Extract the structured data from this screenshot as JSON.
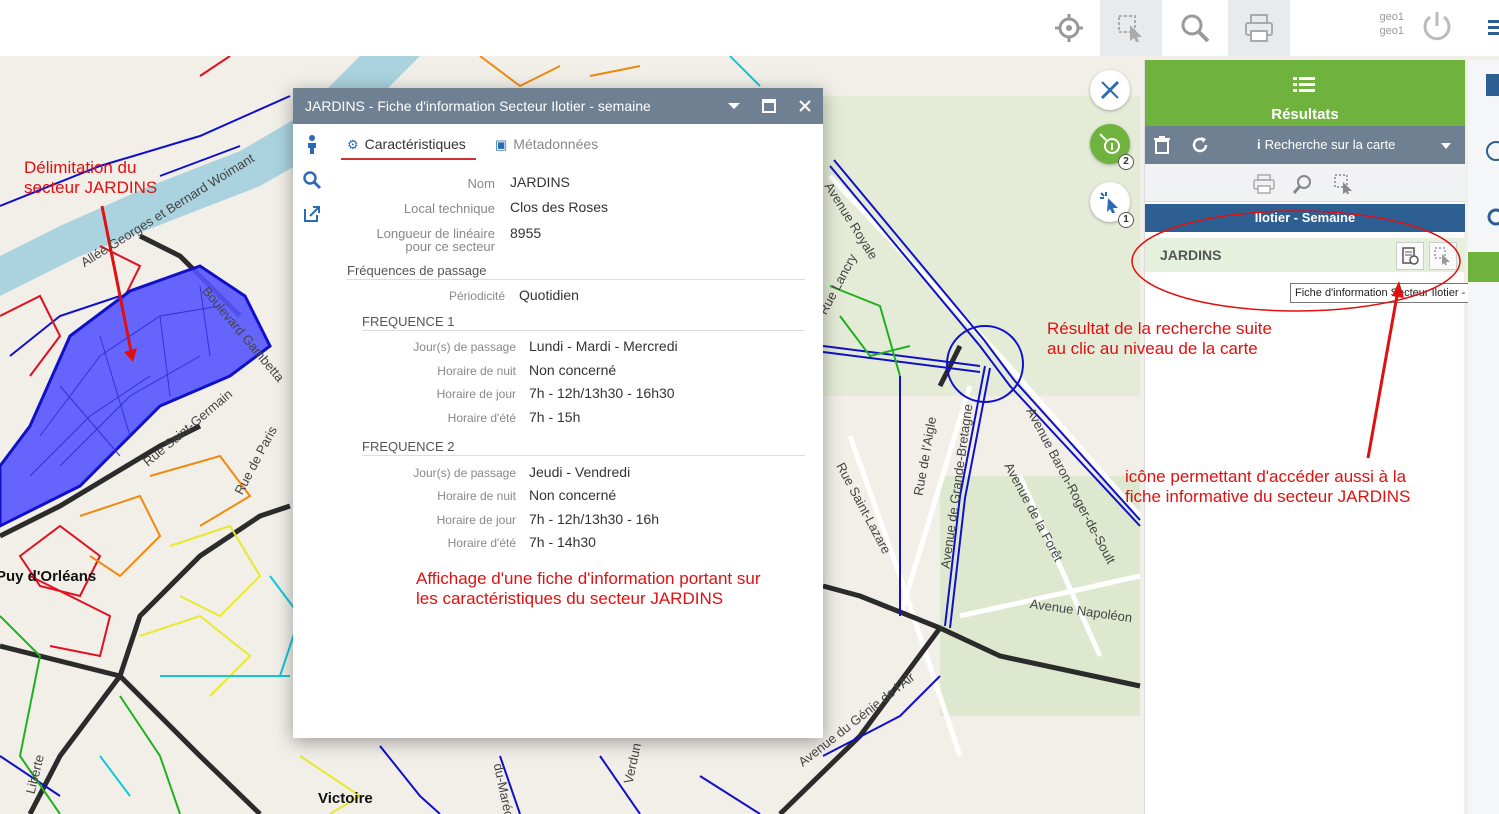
{
  "toolbar": {
    "user_line1": "geo1",
    "user_line2": "geo1",
    "buttons": [
      "settings-icon",
      "select-tool-icon",
      "search-icon",
      "print-icon"
    ]
  },
  "map": {
    "labels": {
      "allee": "Allée Georges et Bernard Woimant",
      "boulevard": "Boulevard Gambetta",
      "saint_germain": "Rue Saint-Germain",
      "rue_paris": "Rue de Paris",
      "puy": "Puy d'Orléans",
      "victoire": "Victoire",
      "royale": "Avenue Royale",
      "lancry": "Rue Lancry",
      "aigle": "Rue de l'Aigle",
      "bretagne": "Avenue de Grande-Bretagne",
      "baron": "Avenue Baron-Roger-de-Soult",
      "foret": "Avenue de la Forêt",
      "napoleon": "Avenue Napoléon",
      "saint_lazare": "Rue Saint-Lazare",
      "genie": "Avenue du Génie de l'Air",
      "verdun": "Verdun",
      "marechal": "du-Maréchal",
      "liberte": "Libérte"
    }
  },
  "dialog": {
    "title": "JARDINS - Fiche d'information Secteur Ilotier - semaine",
    "tab_active": "Caractéristiques",
    "tab_inactive": "Métadonnées",
    "fields": {
      "nom_label": "Nom",
      "nom_value": "JARDINS",
      "local_label": "Local technique",
      "local_value": "Clos des Roses",
      "longueur_label": "Longueur de linéaire pour ce secteur",
      "longueur_value": "8955"
    },
    "frequences_title": "Fréquences de passage",
    "periodicite_label": "Périodicité",
    "periodicite_value": "Quotidien",
    "frequence1": {
      "title": "FREQUENCE 1",
      "jours_label": "Jour(s) de passage",
      "jours_value": "Lundi - Mardi - Mercredi",
      "nuit_label": "Horaire de nuit",
      "nuit_value": "Non concerné",
      "jour_label": "Horaire de jour",
      "jour_value": "7h - 12h/13h30 - 16h30",
      "ete_label": "Horaire d'été",
      "ete_value": "7h - 15h"
    },
    "frequence2": {
      "title": "FREQUENCE 2",
      "jours_label": "Jour(s) de passage",
      "jours_value": "Jeudi - Vendredi",
      "nuit_label": "Horaire de nuit",
      "nuit_value": "Non concerné",
      "jour_label": "Horaire de jour",
      "jour_value": "7h - 12h/13h30 - 16h",
      "ete_label": "Horaire d'été",
      "ete_value": "7h - 14h30"
    }
  },
  "map_tools": {
    "badge_info": "2",
    "badge_select": "1"
  },
  "panel": {
    "title": "Résultats",
    "search_label": "Recherche sur la carte",
    "layer_title": "Ilotier - Semaine",
    "result_name": "JARDINS",
    "tooltip": "Fiche d'information Secteur Ilotier - semaine"
  },
  "annotations": {
    "delimitation_1": "Délimitation du",
    "delimitation_2": "secteur JARDINS",
    "resultat_1": "Résultat de la recherche suite",
    "resultat_2": "au clic au niveau de la carte",
    "icone_1": "icône permettant d'accéder aussi à la",
    "icone_2": "fiche informative du secteur JARDINS",
    "affichage_1": "Affichage d'une fiche d'information portant sur",
    "affichage_2": "les caractéristiques du secteur JARDINS"
  },
  "colors": {
    "panel_green": "#6fb33e",
    "header_gray": "#6e8092",
    "layer_blue": "#2d5f93",
    "sector_fill": "#5555ff",
    "annotation_red": "#e01010",
    "tab_underline": "#cc3333"
  }
}
